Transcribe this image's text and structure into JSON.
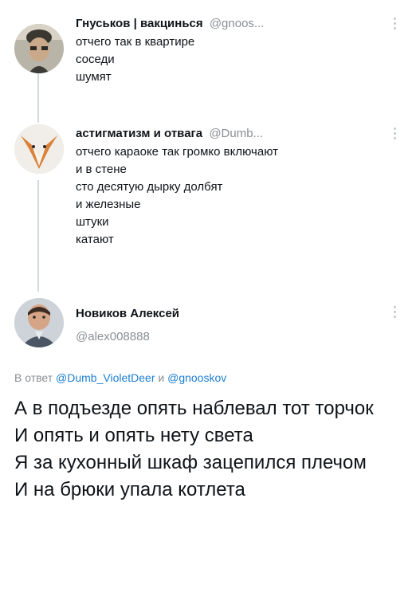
{
  "tweets": [
    {
      "name": "Гнуськов | вакцинься",
      "handle": "@gnoos...",
      "lines": [
        "отчего так в квартире",
        "соседи",
        "шумят"
      ]
    },
    {
      "name": "астигматизм и отвага",
      "handle": "@Dumb...",
      "lines": [
        "отчего караоке так громко включают",
        "и в стене",
        "сто десятую дырку долбят",
        "и железные",
        "штуки",
        "катают"
      ]
    }
  ],
  "main_tweet": {
    "name": "Новиков Алексей",
    "handle": "@alex008888",
    "reply_prefix": "В ответ",
    "reply_mention_1": "@Dumb_VioletDeer",
    "reply_and": "и",
    "reply_mention_2": "@gnooskov",
    "lines": [
      "А в подъезде опять наблевал тот торчок",
      "И опять и опять нету света",
      "Я за кухонный шкаф зацепился плечом",
      "И на брюки упала котлета"
    ]
  },
  "icons": {
    "more": "more-vertical-icon",
    "avatar_1": "avatar",
    "avatar_2": "avatar",
    "avatar_3": "avatar"
  }
}
